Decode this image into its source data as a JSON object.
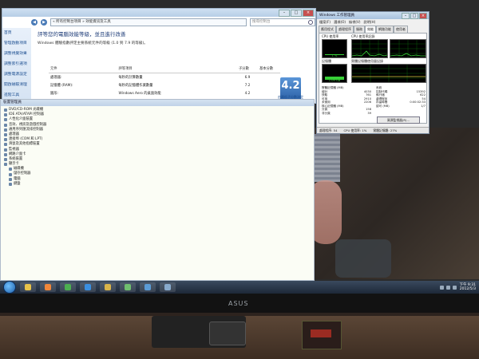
{
  "monitor": {
    "brand": "ASUS"
  },
  "performance_window": {
    "breadcrumb": "« 所有控制台項目 » 效能資訊及工具",
    "search_placeholder": "搜尋控制台",
    "sidebar": [
      "首頁",
      "管理啟動項目",
      "調整視覺效果",
      "調整索引選項",
      "調整電源設定",
      "開啟磁碟清理",
      "進階工具"
    ],
    "heading": "評等您的電腦效能等級，並且進行改善",
    "description": "Windows 體驗指數評定主要系統元件的等級 (1.0 到 7.9 的等級)。",
    "table_headers": {
      "component": "元件",
      "rating": "評等項目",
      "subscore": "子分數",
      "base": "基本分數"
    },
    "rows": [
      {
        "component": "處理器:",
        "rating": "每秒的計算數量",
        "subscore": "6.9"
      },
      {
        "component": "記憶體 (RAM):",
        "rating": "每秒的記憶體作業數量",
        "subscore": "7.2"
      },
      {
        "component": "圖形:",
        "rating": "Windows Aero 的桌面效能",
        "subscore": "4.2"
      },
      {
        "component": "遊戲圖形:",
        "rating": "3D 商務和遊戲圖形效能",
        "subscore": "6.4"
      },
      {
        "component": "主要硬碟:",
        "rating": "磁碟資料傳輸速率",
        "subscore": "5.9"
      }
    ],
    "base_score": "4.2",
    "base_score_caption": "由最低子分數決定"
  },
  "device_manager": {
    "title": "裝置管理員",
    "items": [
      {
        "label": "DVD/CD-ROM 光碟機",
        "indent": false
      },
      {
        "label": "IDE ATA/ATAPI 控制器",
        "indent": false
      },
      {
        "label": "人性化介面裝置",
        "indent": false
      },
      {
        "label": "音效、視訊及遊戲控制器",
        "indent": false
      },
      {
        "label": "通用序列匯流排控制器",
        "indent": false
      },
      {
        "label": "處理器",
        "indent": false
      },
      {
        "label": "連接埠 (COM 和 LPT)",
        "indent": false
      },
      {
        "label": "滑鼠及其他指標裝置",
        "indent": false
      },
      {
        "label": "監視器",
        "indent": false
      },
      {
        "label": "網路介面卡",
        "indent": false
      },
      {
        "label": "系統裝置",
        "indent": false
      },
      {
        "label": "顯示卡",
        "indent": false
      },
      {
        "label": "磁碟機",
        "indent": true
      },
      {
        "label": "儲存控制器",
        "indent": true
      },
      {
        "label": "電腦",
        "indent": true
      },
      {
        "label": "鍵盤",
        "indent": true
      }
    ]
  },
  "task_manager": {
    "title": "Windows 工作管理員",
    "menu": [
      "檔案(F)",
      "選項(O)",
      "檢視(V)",
      "說明(H)"
    ],
    "tabs": [
      "應用程式",
      "處理程序",
      "服務",
      "效能",
      "網路功能",
      "使用者"
    ],
    "active_tab": "效能",
    "cpu_label": "CPU 使用率",
    "cpu_history_label": "CPU 使用率記錄",
    "cpu_value": "1 %",
    "cpu_fraction": 0.06,
    "mem_label": "記憶體",
    "mem_history_label": "實體記憶體使用量記錄",
    "mem_value": "1.09 GB",
    "mem_fraction": 0.28,
    "stats_left_title": "實體記憶體 (MB)",
    "stats_left": [
      {
        "k": "總計",
        "v": "4030"
      },
      {
        "k": "快取",
        "v": "761"
      },
      {
        "k": "可用",
        "v": "2910"
      },
      {
        "k": "未使用",
        "v": "2206"
      },
      {
        "k": "核心記憶體 (MB)",
        "v": ""
      },
      {
        "k": "分頁",
        "v": "158"
      },
      {
        "k": "非分頁",
        "v": "39"
      }
    ],
    "stats_right_title": "系統",
    "stats_right": [
      {
        "k": "控制代碼",
        "v": "15392"
      },
      {
        "k": "執行緒",
        "v": "622"
      },
      {
        "k": "處理程序",
        "v": "54"
      },
      {
        "k": "存留時間",
        "v": "0:00:02:33"
      },
      {
        "k": "認可 (MB)",
        "v": "1/7"
      }
    ],
    "resource_button": "資源監視器(R)...",
    "status": {
      "processes": "處理程序: 54",
      "cpu": "CPU 使用率: 1%",
      "memory": "實體記憶體: 27%"
    }
  },
  "taskbar": {
    "apps": [
      {
        "name": "explorer-app",
        "color": "#e8c34a"
      },
      {
        "name": "media-player-app",
        "color": "#f0873a"
      },
      {
        "name": "chrome-app",
        "color": "#4caf50"
      },
      {
        "name": "ie-app",
        "color": "#3a8fe0"
      },
      {
        "name": "folder-app",
        "color": "#d9b44a"
      },
      {
        "name": "task-manager-app",
        "color": "#6fbf6f"
      },
      {
        "name": "control-panel-app",
        "color": "#5b9bd5"
      },
      {
        "name": "monitor-app",
        "color": "#88aacc"
      }
    ],
    "clock_time": "下午 9:31",
    "clock_date": "2012/5/3"
  }
}
